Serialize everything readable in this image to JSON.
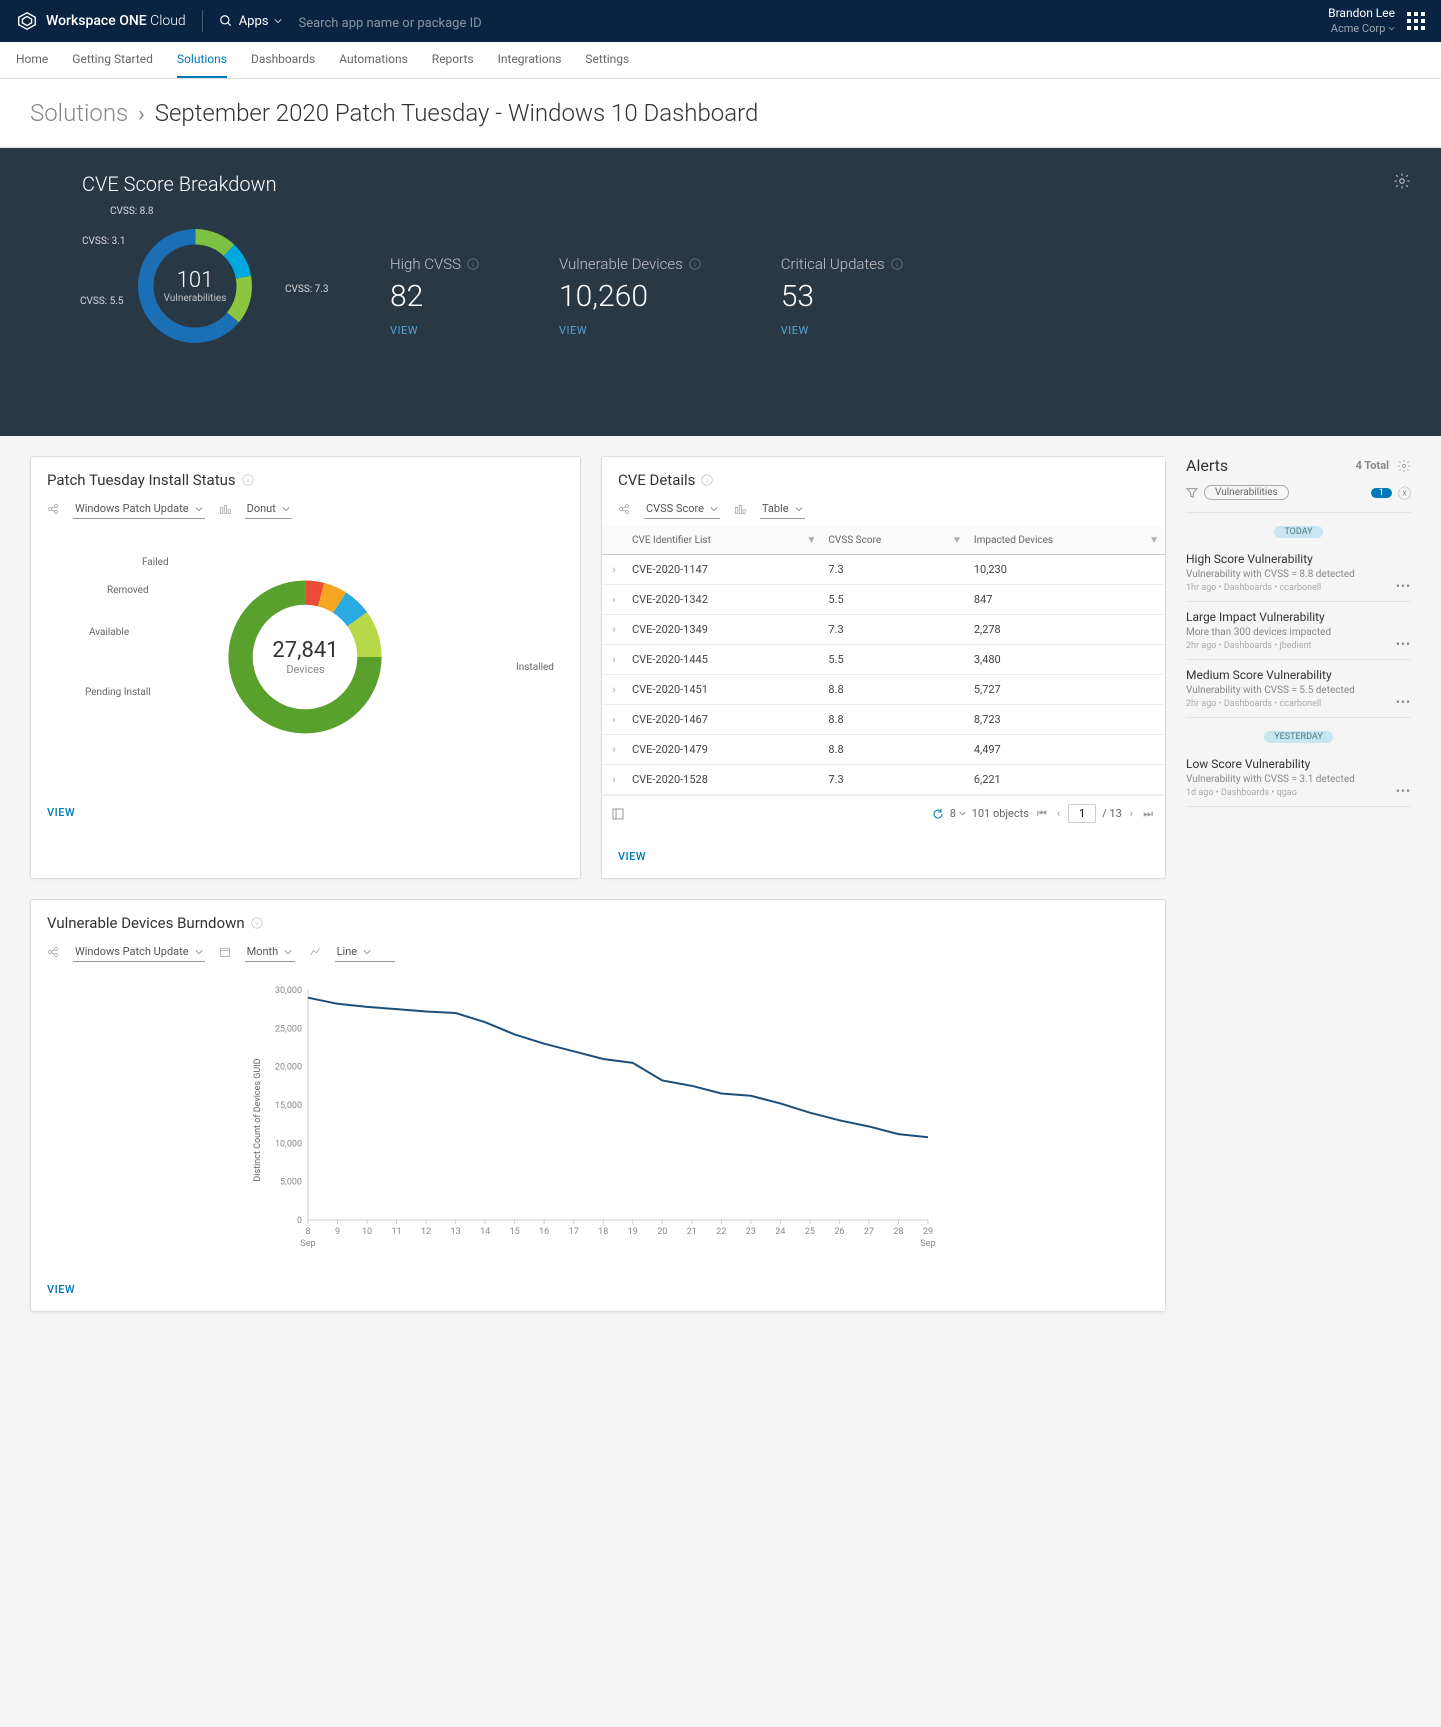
{
  "brand": {
    "name_a": "Workspace ONE",
    "name_b": "Cloud"
  },
  "apps_label": "Apps",
  "search_placeholder": "Search app name or package ID",
  "user": {
    "name": "Brandon Lee",
    "org": "Acme Corp"
  },
  "tabs": [
    "Home",
    "Getting Started",
    "Solutions",
    "Dashboards",
    "Automations",
    "Reports",
    "Integrations",
    "Settings"
  ],
  "tabs_active": 2,
  "breadcrumb": {
    "root": "Solutions",
    "title": "September 2020 Patch Tuesday - Windows 10 Dashboard"
  },
  "hero": {
    "title": "CVE Score Breakdown",
    "donut": {
      "center_value": "101",
      "center_label": "Vulnerabilities",
      "segments": [
        {
          "label": "CVSS: 8.8",
          "color": "#7cc142",
          "pct": 12
        },
        {
          "label": "CVSS: 3.1",
          "color": "#00a8e1",
          "pct": 10
        },
        {
          "label": "CVSS: 5.5",
          "color": "#8cc63f",
          "pct": 14
        },
        {
          "label": "CVSS: 7.3",
          "color": "#1b6fb5",
          "pct": 64
        }
      ]
    },
    "stats": [
      {
        "label": "High CVSS",
        "value": "82",
        "link": "VIEW"
      },
      {
        "label": "Vulnerable Devices",
        "value": "10,260",
        "link": "VIEW"
      },
      {
        "label": "Critical Updates",
        "value": "53",
        "link": "VIEW"
      }
    ]
  },
  "patch": {
    "title": "Patch Tuesday Install Status",
    "filter1": "Windows Patch Update",
    "filter2": "Donut",
    "center_value": "27,841",
    "center_label": "Devices",
    "segments": [
      {
        "label": "Failed",
        "color": "#e94b35",
        "pct": 4
      },
      {
        "label": "Removed",
        "color": "#f5a623",
        "pct": 5
      },
      {
        "label": "Available",
        "color": "#29abe2",
        "pct": 6
      },
      {
        "label": "Pending Install",
        "color": "#b8d84a",
        "pct": 10
      },
      {
        "label": "Installed",
        "color": "#5aa02c",
        "pct": 75
      }
    ],
    "view": "VIEW"
  },
  "cve": {
    "title": "CVE Details",
    "filter1": "CVSS Score",
    "filter2": "Table",
    "cols": [
      "CVE Identifier List",
      "CVSS Score",
      "Impacted Devices"
    ],
    "rows": [
      {
        "id": "CVE-2020-1147",
        "score": "7.3",
        "devices": "10,230"
      },
      {
        "id": "CVE-2020-1342",
        "score": "5.5",
        "devices": "847"
      },
      {
        "id": "CVE-2020-1349",
        "score": "7.3",
        "devices": "2,278"
      },
      {
        "id": "CVE-2020-1445",
        "score": "5.5",
        "devices": "3,480"
      },
      {
        "id": "CVE-2020-1451",
        "score": "8.8",
        "devices": "5,727"
      },
      {
        "id": "CVE-2020-1467",
        "score": "8.8",
        "devices": "8,723"
      },
      {
        "id": "CVE-2020-1479",
        "score": "8.8",
        "devices": "4,497"
      },
      {
        "id": "CVE-2020-1528",
        "score": "7.3",
        "devices": "6,221"
      }
    ],
    "pager": {
      "size": "8",
      "total_objects": "101 objects",
      "page": "1",
      "pages": "/ 13"
    },
    "view": "VIEW"
  },
  "burndown": {
    "title": "Vulnerable Devices Burndown",
    "filter1": "Windows Patch Update",
    "filter2": "Month",
    "filter3": "Line",
    "view": "VIEW",
    "ylabel": "Distinct Count of Devices GUID"
  },
  "chart_data": {
    "type": "line",
    "title": "Vulnerable Devices Burndown",
    "xlabel": "Sep",
    "ylabel": "Distinct Count of Devices GUID",
    "ylim": [
      0,
      30000
    ],
    "yticks": [
      0,
      5000,
      10000,
      15000,
      20000,
      25000,
      30000
    ],
    "x": [
      "8",
      "9",
      "10",
      "11",
      "12",
      "13",
      "14",
      "15",
      "16",
      "17",
      "18",
      "19",
      "20",
      "21",
      "22",
      "23",
      "24",
      "25",
      "26",
      "27",
      "28",
      "29"
    ],
    "values": [
      29000,
      28200,
      27800,
      27500,
      27200,
      27000,
      25800,
      24200,
      23000,
      22000,
      21000,
      20500,
      18200,
      17500,
      16500,
      16200,
      15200,
      14000,
      13000,
      12200,
      11200,
      10800
    ]
  },
  "alerts": {
    "title": "Alerts",
    "total": "4 Total",
    "filter_chip": "Vulnerabilities",
    "filter_count": "1",
    "days": [
      {
        "label": "TODAY",
        "items": [
          {
            "title": "High Score Vulnerability",
            "sub": "Vulnerability with CVSS = 8.8 detected",
            "meta": "1hr ago • Dashboards • ccarbonell"
          },
          {
            "title": "Large Impact Vulnerability",
            "sub": "More than 300 devices impacted",
            "meta": "2hr ago • Dashboards • jbedient"
          },
          {
            "title": "Medium Score Vulnerability",
            "sub": "Vulnerability with CVSS = 5.5 detected",
            "meta": "2hr ago • Dashboards • ccarbonell"
          }
        ]
      },
      {
        "label": "YESTERDAY",
        "items": [
          {
            "title": "Low Score Vulnerability",
            "sub": "Vulnerability with CVSS = 3.1 detected",
            "meta": "1d ago • Dashboards • qgao"
          }
        ]
      }
    ]
  }
}
